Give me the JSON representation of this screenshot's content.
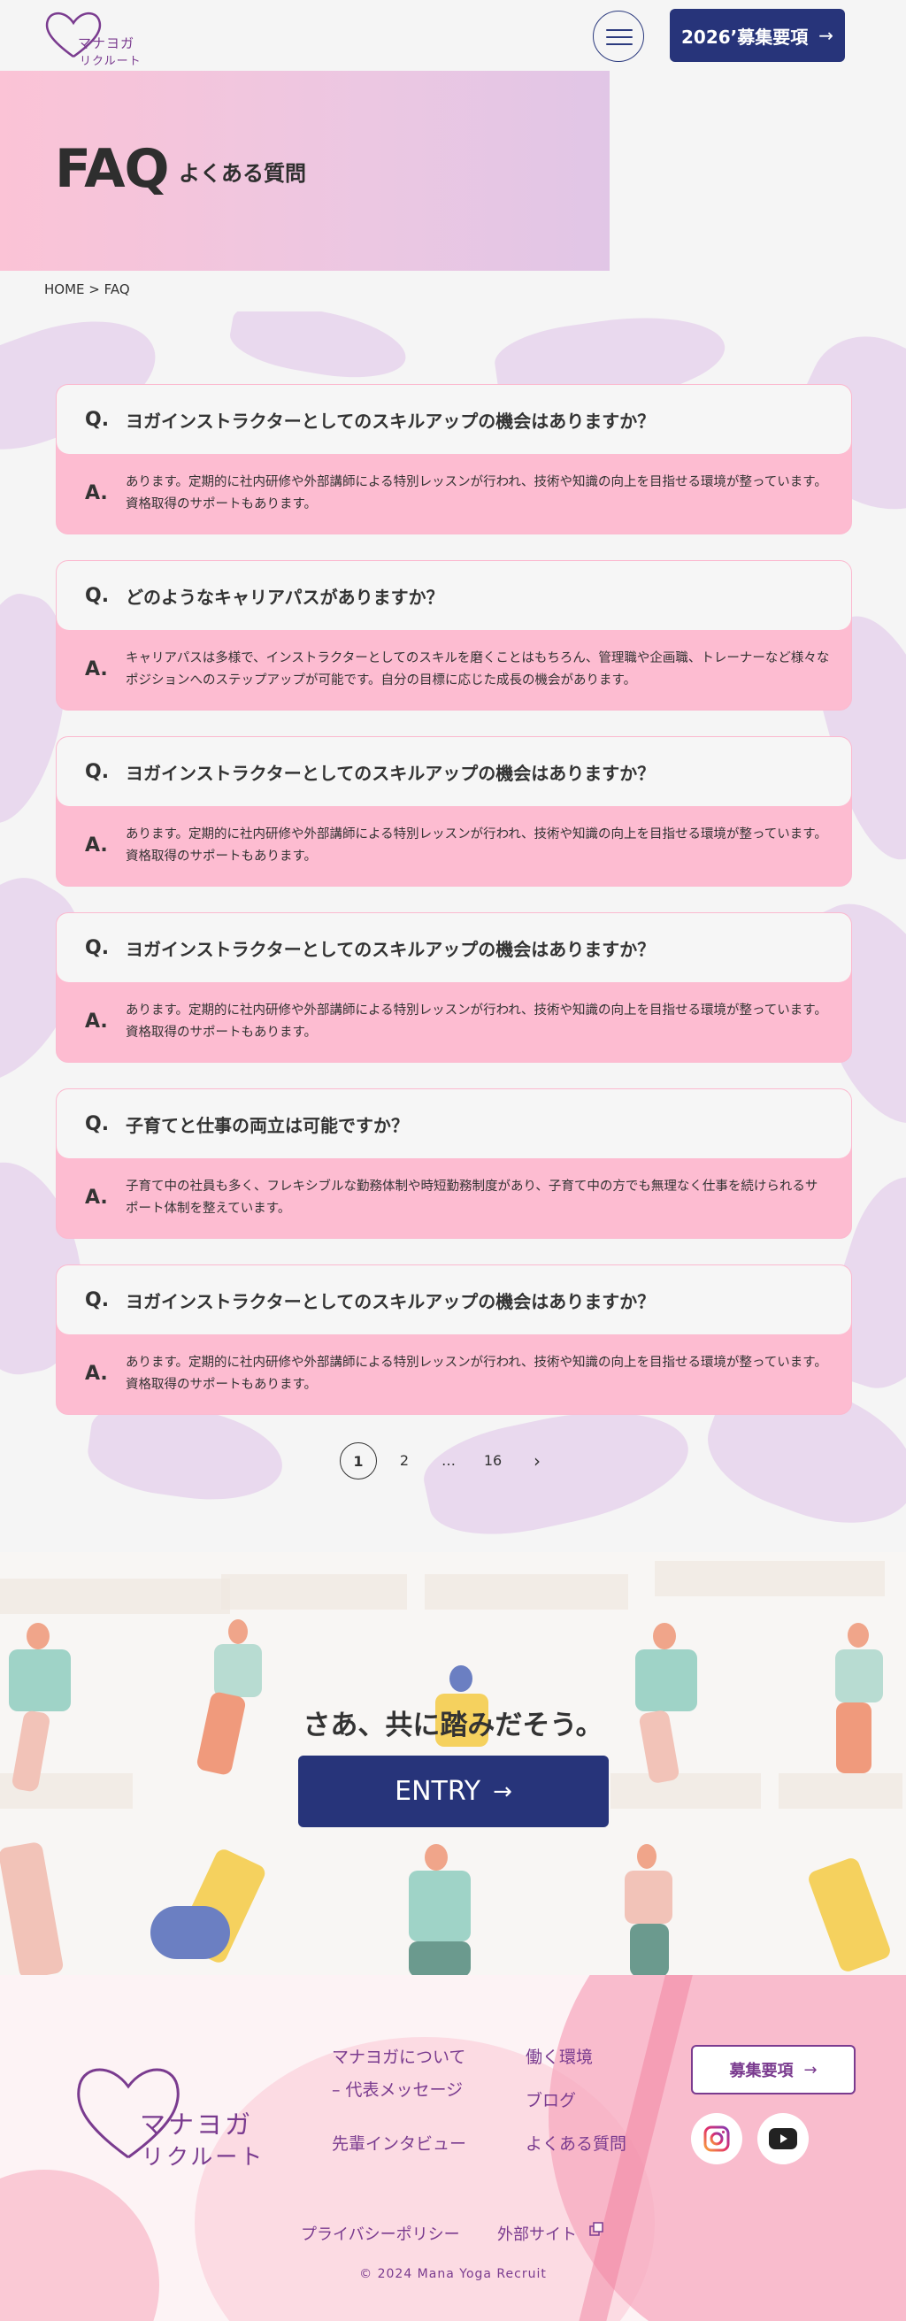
{
  "header": {
    "logo_line1": "マナヨガ",
    "logo_line2": "リクルート",
    "recruit_label": "2026’募集要項",
    "recruit_arrow": "→"
  },
  "hero": {
    "title": "FAQ",
    "subtitle": "よくある質問"
  },
  "breadcrumb": "HOME > FAQ",
  "faq": {
    "q_mark": "Q.",
    "a_mark": "A.",
    "items": [
      {
        "question": "ヨガインストラクターとしてのスキルアップの機会はありますか？",
        "answer": "あります。定期的に社内研修や外部講師による特別レッスンが行われ、技術や知識の向上を目指せる環境が整っています。資格取得のサポートもあります。"
      },
      {
        "question": "どのようなキャリアパスがありますか？",
        "answer": "キャリアパスは多様で、インストラクターとしてのスキルを磨くことはもちろん、管理職や企画職、トレーナーなど様々なポジションへのステップアップが可能です。自分の目標に応じた成長の機会があります。"
      },
      {
        "question": "ヨガインストラクターとしてのスキルアップの機会はありますか？",
        "answer": "あります。定期的に社内研修や外部講師による特別レッスンが行われ、技術や知識の向上を目指せる環境が整っています。資格取得のサポートもあります。"
      },
      {
        "question": "ヨガインストラクターとしてのスキルアップの機会はありますか？",
        "answer": "あります。定期的に社内研修や外部講師による特別レッスンが行われ、技術や知識の向上を目指せる環境が整っています。資格取得のサポートもあります。"
      },
      {
        "question": "子育てと仕事の両立は可能ですか？",
        "answer": "子育て中の社員も多く、フレキシブルな勤務体制や時短勤務制度があり、子育て中の方でも無理なく仕事を続けられるサポート体制を整えています。"
      },
      {
        "question": "ヨガインストラクターとしてのスキルアップの機会はありますか？",
        "answer": "あります。定期的に社内研修や外部講師による特別レッスンが行われ、技術や知識の向上を目指せる環境が整っています。資格取得のサポートもあります。"
      }
    ]
  },
  "pagination": {
    "pages": [
      "1",
      "2",
      "…",
      "16"
    ],
    "current": "1",
    "next": "›"
  },
  "entry": {
    "message": "さあ、共に踏みだそう。",
    "button_label": "ENTRY",
    "button_arrow": "→"
  },
  "footer": {
    "logo_line1": "マナヨガ",
    "logo_line2": "リクルート",
    "links": {
      "about_line1": "マナヨガについて",
      "about_line2": "– 代表メッセージ",
      "interview": "先輩インタビュー",
      "environment": "働く環境",
      "blog": "ブログ",
      "faq": "よくある質問"
    },
    "recruit_button": "募集要項",
    "recruit_arrow": "→",
    "privacy": "プライバシーポリシー",
    "external": "外部サイト",
    "copyright": "© 2024 Mana Yoga Recruit"
  },
  "colors": {
    "navy": "#27347a",
    "purple": "#7a3b8f",
    "pink": "#fdbcd1",
    "hero_gradient_start": "#fbc3d6",
    "hero_gradient_end": "#e1c6e6"
  },
  "icons": [
    "heart-logo-icon",
    "hamburger-menu-icon",
    "arrow-right-icon",
    "chevron-right-icon",
    "instagram-icon",
    "youtube-icon",
    "external-link-icon"
  ]
}
